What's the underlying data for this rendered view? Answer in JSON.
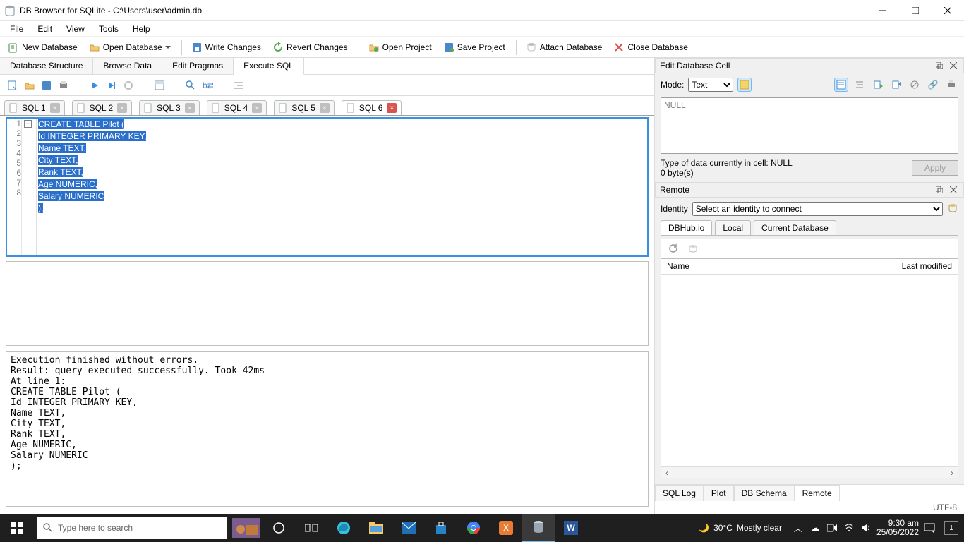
{
  "window": {
    "title": "DB Browser for SQLite - C:\\Users\\user\\admin.db"
  },
  "menu": {
    "items": [
      "File",
      "Edit",
      "View",
      "Tools",
      "Help"
    ]
  },
  "toolbar": {
    "new_db": "New Database",
    "open_db": "Open Database",
    "write_changes": "Write Changes",
    "revert_changes": "Revert Changes",
    "open_project": "Open Project",
    "save_project": "Save Project",
    "attach_db": "Attach Database",
    "close_db": "Close Database"
  },
  "main_tabs": {
    "structure": "Database Structure",
    "browse": "Browse Data",
    "pragmas": "Edit Pragmas",
    "execute": "Execute SQL"
  },
  "sql_tabs": [
    "SQL 1",
    "SQL 2",
    "SQL 3",
    "SQL 4",
    "SQL 5",
    "SQL 6"
  ],
  "editor": {
    "lines": [
      "CREATE TABLE Pilot (",
      "Id INTEGER PRIMARY KEY,",
      "Name TEXT,",
      "City TEXT,",
      "Rank TEXT,",
      "Age NUMERIC,",
      "Salary NUMERIC",
      ");"
    ]
  },
  "log": "Execution finished without errors.\nResult: query executed successfully. Took 42ms\nAt line 1:\nCREATE TABLE Pilot (\nId INTEGER PRIMARY KEY,\nName TEXT,\nCity TEXT,\nRank TEXT,\nAge NUMERIC,\nSalary NUMERIC\n);",
  "right": {
    "edit_cell_title": "Edit Database Cell",
    "mode_label": "Mode:",
    "mode_value": "Text",
    "null": "NULL",
    "type_info": "Type of data currently in cell: NULL",
    "size_info": "0 byte(s)",
    "apply": "Apply",
    "remote_title": "Remote",
    "identity_label": "Identity",
    "identity_value": "Select an identity to connect",
    "remote_tabs": {
      "dbhub": "DBHub.io",
      "local": "Local",
      "current": "Current Database"
    },
    "cols": {
      "name": "Name",
      "modified": "Last modified"
    }
  },
  "bottom_tabs": {
    "log": "SQL Log",
    "plot": "Plot",
    "schema": "DB Schema",
    "remote": "Remote"
  },
  "status": {
    "encoding": "UTF-8"
  },
  "taskbar": {
    "search_placeholder": "Type here to search",
    "temp": "30°C",
    "weather": "Mostly clear",
    "time": "9:30 am",
    "date": "25/05/2022",
    "notif": "1"
  }
}
